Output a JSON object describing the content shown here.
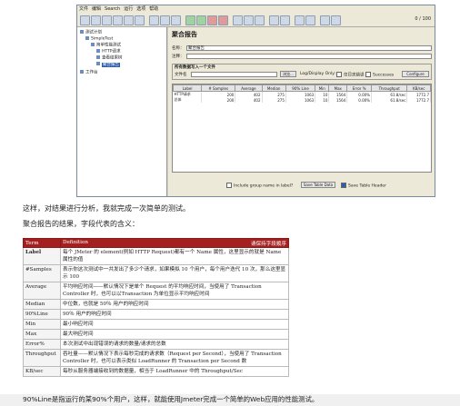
{
  "jmeter": {
    "menu": [
      "文件",
      "编辑",
      "Search",
      "运行",
      "选项",
      "帮助"
    ],
    "counter": "0 / 100",
    "tree": [
      "测试计划",
      "SimpleTest",
      "简单性能测试",
      "HTTP请求",
      "查看结果树",
      "聚合报告",
      "工作台"
    ],
    "panel": {
      "title": "聚合报告",
      "name_label": "名称：",
      "name_value": "聚合报告",
      "comment_label": "注释：",
      "file_section": "所有数据写入一个文件",
      "filename_label": "文件名",
      "browse": "浏览...",
      "log_only": "Log/Display Only:",
      "errors": "仅日志错误",
      "successes": "Successes",
      "configure": "Configure",
      "columns": [
        "Label",
        "# Samples",
        "Average",
        "Median",
        "90% Line",
        "Min",
        "Max",
        "Error %",
        "Throughput",
        "KB/sec"
      ],
      "rows": [
        [
          "HTTP请求",
          "200",
          "402",
          "275",
          "1063",
          "10",
          "1564",
          "0.00%",
          "61.8/sec",
          "1772.7"
        ],
        [
          "总体",
          "200",
          "402",
          "275",
          "1063",
          "10",
          "1564",
          "0.00%",
          "61.8/sec",
          "1772.7"
        ]
      ],
      "include_group": "Include group name in label?",
      "save_table": "Save Table Data",
      "save_header": "Save Table Header"
    }
  },
  "text1": "这样，对结果进行分析，我就完成一次简单的测试。",
  "text2": "聚合报告的结果，字段代表的含义：",
  "def": {
    "h_term": "Term",
    "h_def": "Definition",
    "h_note": "请保持字段顺序",
    "rows": [
      [
        "Label",
        "每个 JMeter 的 element(例如 HTTP Request)都有一个 Name 属性，这里显示的就是 Name 属性的值"
      ],
      [
        "#Samples",
        "表示你这次测试中一共发出了多少个请求，如果模拟 10 个用户，每个用户迭代 10 次，那么这里显示 100"
      ],
      [
        "Average",
        "平均响应时间——默认情况下是单个 Request 的平均响应时间，当使用了 Transaction Controller 时，也可以以Transaction 为单位显示平均响应时间"
      ],
      [
        "Median",
        "中位数，也就是 50％ 用户的响应时间"
      ],
      [
        "90%Line",
        "90％ 用户的响应时间"
      ],
      [
        "Min",
        "最小响应时间"
      ],
      [
        "Max",
        "最大响应时间"
      ],
      [
        "Error%",
        "本次测试中出现错误的请求的数量/请求的总数"
      ],
      [
        "Throughput",
        "吞吐量——默认情况下表示每秒完成的请求数（Request per Second），当使用了 Transaction Controller 时，也可以表示类似 LoadRunner 的 Transaction per Second 数"
      ],
      [
        "KB/sec",
        "每秒从服务器端接收到的数据量，相当于 LoadRunner 中的 Throughput/Sec"
      ]
    ]
  },
  "text3": "90%Line是指运行的某90%个用户，这样，就能使用Jmeter完成一个简单的Web应用的性能测试。"
}
